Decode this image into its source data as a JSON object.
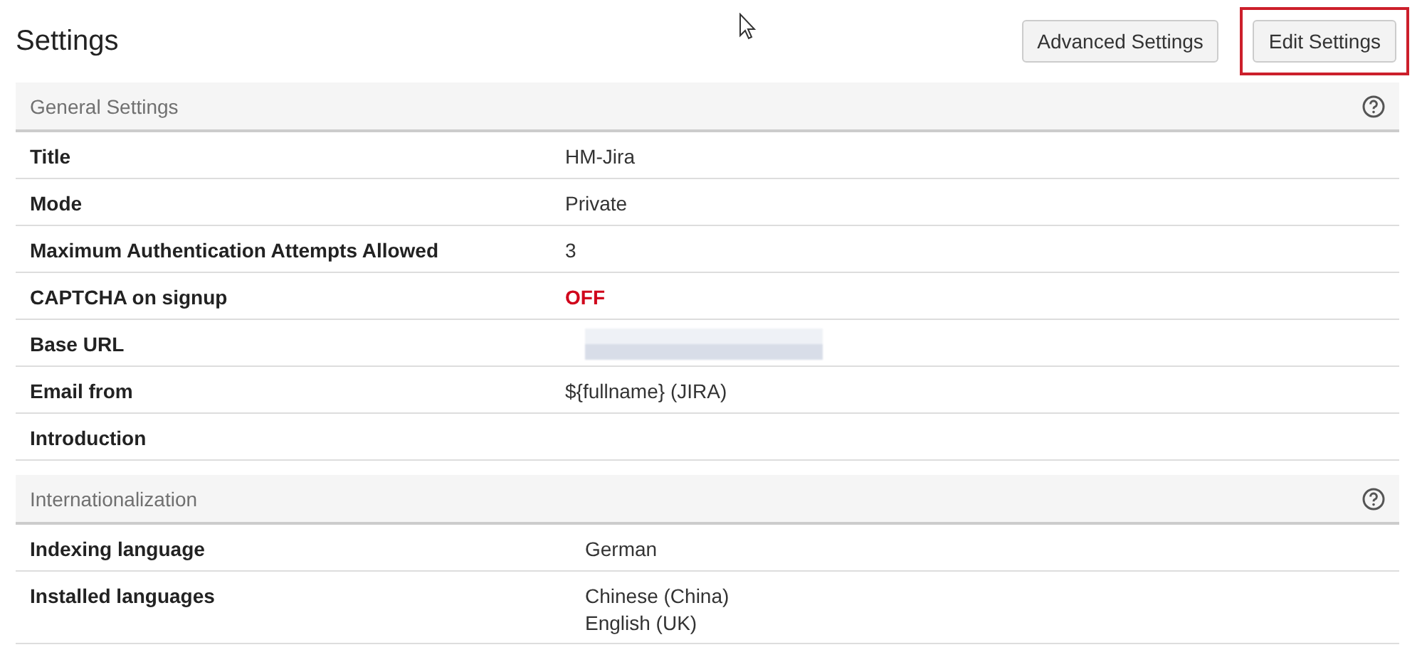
{
  "page": {
    "title": "Settings"
  },
  "buttons": [
    {
      "label": "Advanced Settings",
      "highlighted": false
    },
    {
      "label": "Edit Settings",
      "highlighted": true
    }
  ],
  "sections": [
    {
      "title": "General Settings",
      "rows": [
        {
          "label": "Title",
          "kind": "text",
          "value": "HM-Jira"
        },
        {
          "label": "Mode",
          "kind": "text",
          "value": "Private"
        },
        {
          "label": "Maximum Authentication Attempts Allowed",
          "kind": "text",
          "value": "3"
        },
        {
          "label": "CAPTCHA on signup",
          "kind": "status",
          "value": "OFF"
        },
        {
          "label": "Base URL",
          "kind": "redacted"
        },
        {
          "label": "Email from",
          "kind": "text",
          "value": "${fullname} (JIRA)"
        },
        {
          "label": "Introduction",
          "kind": "text"
        }
      ]
    },
    {
      "title": "Internationalization",
      "rows": [
        {
          "label": "Indexing language",
          "kind": "language",
          "value": "German"
        },
        {
          "label": "Installed languages",
          "kind": "languages",
          "values": [
            "Chinese (China)",
            "English (UK)"
          ]
        }
      ]
    }
  ]
}
